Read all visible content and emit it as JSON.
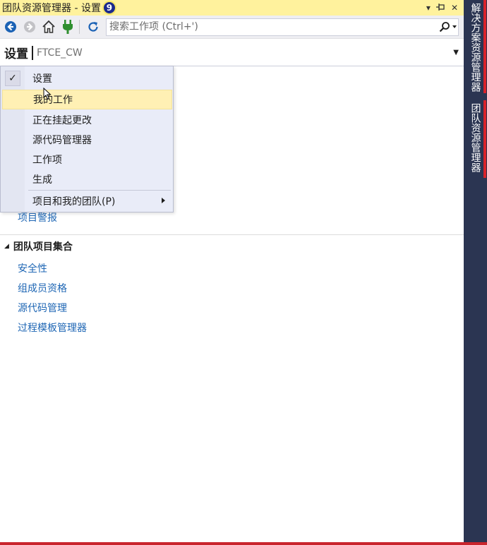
{
  "window": {
    "title": "团队资源管理器 - 设置",
    "badge": "9",
    "controls": {
      "dropdown": "▾",
      "pin": "⊣",
      "close": "✕"
    }
  },
  "toolbar": {
    "search_placeholder": "搜索工作项 (Ctrl+')",
    "icons": [
      "back-icon",
      "forward-icon",
      "home-icon",
      "connect-icon",
      "refresh-icon",
      "search-icon"
    ]
  },
  "header": {
    "title": "设置",
    "subtitle": "FTCE_CW",
    "dropdown": "▼"
  },
  "menu": {
    "items": [
      {
        "label": "设置",
        "checked": true
      },
      {
        "label": "我的工作",
        "highlighted": true
      },
      {
        "label": "正在挂起更改"
      },
      {
        "label": "源代码管理器"
      },
      {
        "label": "工作项"
      },
      {
        "label": "生成"
      }
    ],
    "submenu_item": {
      "label": "项目和我的团队(P)",
      "arrow": "▶"
    },
    "check_glyph": "✓"
  },
  "content": {
    "partial_link": "项目警报",
    "section_title": "团队项目集合",
    "section_toggle": "◢",
    "links": [
      "安全性",
      "组成员资格",
      "源代码管理",
      "过程模板管理器"
    ]
  },
  "dock": {
    "tabs": [
      "解决方案资源管理器",
      "团队资源管理器"
    ]
  },
  "colors": {
    "titlebar": "#fff29d",
    "dock": "#2b3552",
    "link": "#1e66b4",
    "accent_red": "#c9252d",
    "menu_highlight": "#fff0b4"
  }
}
